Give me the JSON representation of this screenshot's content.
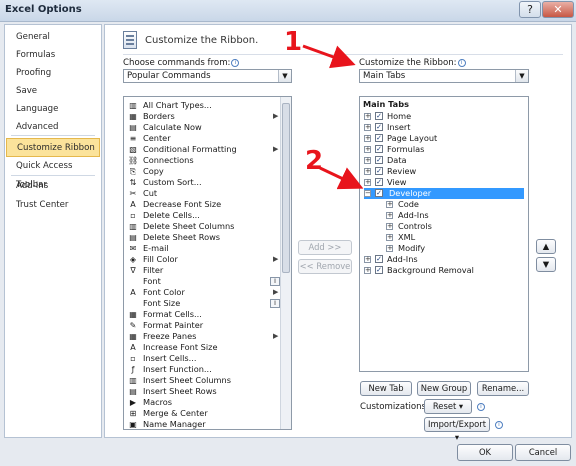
{
  "window": {
    "title": "Excel Options",
    "help_label": "?",
    "close_label": "✕"
  },
  "nav": {
    "items": [
      {
        "label": "General"
      },
      {
        "label": "Formulas"
      },
      {
        "label": "Proofing"
      },
      {
        "label": "Save"
      },
      {
        "label": "Language"
      },
      {
        "label": "Advanced"
      },
      {
        "label": "Customize Ribbon",
        "selected": true
      },
      {
        "label": "Quick Access Toolbar"
      },
      {
        "label": "Add-Ins"
      },
      {
        "label": "Trust Center"
      }
    ]
  },
  "panel": {
    "heading": "Customize the Ribbon.",
    "choose_label": "Choose commands from:",
    "choose_value": "Popular Commands",
    "customize_label": "Customize the Ribbon:",
    "customize_value": "Main Tabs"
  },
  "commands": [
    {
      "label": "All Chart Types...",
      "icon": "▥",
      "icon_name": "chart-icon"
    },
    {
      "label": "Borders",
      "icon": "▦",
      "icon_name": "borders-icon",
      "submenu": true
    },
    {
      "label": "Calculate Now",
      "icon": "▤",
      "icon_name": "calculate-icon"
    },
    {
      "label": "Center",
      "icon": "≡",
      "icon_name": "center-align-icon"
    },
    {
      "label": "Conditional Formatting",
      "icon": "▧",
      "icon_name": "conditional-format-icon",
      "submenu": true
    },
    {
      "label": "Connections",
      "icon": "⛓",
      "icon_name": "connections-icon"
    },
    {
      "label": "Copy",
      "icon": "⎘",
      "icon_name": "copy-icon"
    },
    {
      "label": "Custom Sort...",
      "icon": "⇅",
      "icon_name": "sort-icon"
    },
    {
      "label": "Cut",
      "icon": "✂",
      "icon_name": "cut-icon"
    },
    {
      "label": "Decrease Font Size",
      "icon": "A",
      "icon_name": "decrease-font-icon"
    },
    {
      "label": "Delete Cells...",
      "icon": "▫",
      "icon_name": "delete-cells-icon"
    },
    {
      "label": "Delete Sheet Columns",
      "icon": "▥",
      "icon_name": "delete-columns-icon"
    },
    {
      "label": "Delete Sheet Rows",
      "icon": "▤",
      "icon_name": "delete-rows-icon"
    },
    {
      "label": "E-mail",
      "icon": "✉",
      "icon_name": "email-icon"
    },
    {
      "label": "Fill Color",
      "icon": "◈",
      "icon_name": "fill-color-icon",
      "submenu": true
    },
    {
      "label": "Filter",
      "icon": "∇",
      "icon_name": "filter-icon"
    },
    {
      "label": "Font",
      "icon": "",
      "icon_name": "font-icon",
      "split": "I"
    },
    {
      "label": "Font Color",
      "icon": "A",
      "icon_name": "font-color-icon",
      "submenu": true
    },
    {
      "label": "Font Size",
      "icon": "",
      "icon_name": "font-size-icon",
      "split": "I"
    },
    {
      "label": "Format Cells...",
      "icon": "▦",
      "icon_name": "format-cells-icon"
    },
    {
      "label": "Format Painter",
      "icon": "✎",
      "icon_name": "format-painter-icon"
    },
    {
      "label": "Freeze Panes",
      "icon": "▦",
      "icon_name": "freeze-panes-icon",
      "submenu": true
    },
    {
      "label": "Increase Font Size",
      "icon": "A",
      "icon_name": "increase-font-icon"
    },
    {
      "label": "Insert Cells...",
      "icon": "▫",
      "icon_name": "insert-cells-icon"
    },
    {
      "label": "Insert Function...",
      "icon": "ƒ",
      "icon_name": "insert-function-icon"
    },
    {
      "label": "Insert Sheet Columns",
      "icon": "▥",
      "icon_name": "insert-columns-icon"
    },
    {
      "label": "Insert Sheet Rows",
      "icon": "▤",
      "icon_name": "insert-rows-icon"
    },
    {
      "label": "Macros",
      "icon": "▶",
      "icon_name": "macros-icon"
    },
    {
      "label": "Merge & Center",
      "icon": "⊞",
      "icon_name": "merge-center-icon"
    },
    {
      "label": "Name Manager",
      "icon": "▣",
      "icon_name": "name-manager-icon"
    }
  ],
  "tree": {
    "header": "Main Tabs",
    "items": [
      {
        "label": "Home",
        "level": 0,
        "expander": "+",
        "checked": true
      },
      {
        "label": "Insert",
        "level": 0,
        "expander": "+",
        "checked": true
      },
      {
        "label": "Page Layout",
        "level": 0,
        "expander": "+",
        "checked": true
      },
      {
        "label": "Formulas",
        "level": 0,
        "expander": "+",
        "checked": true
      },
      {
        "label": "Data",
        "level": 0,
        "expander": "+",
        "checked": true
      },
      {
        "label": "Review",
        "level": 0,
        "expander": "+",
        "checked": true
      },
      {
        "label": "View",
        "level": 0,
        "expander": "+",
        "checked": true
      },
      {
        "label": "Developer",
        "level": 0,
        "expander": "−",
        "checked": true,
        "selected": true
      },
      {
        "label": "Code",
        "level": 1,
        "expander": "+"
      },
      {
        "label": "Add-Ins",
        "level": 1,
        "expander": "+"
      },
      {
        "label": "Controls",
        "level": 1,
        "expander": "+"
      },
      {
        "label": "XML",
        "level": 1,
        "expander": "+"
      },
      {
        "label": "Modify",
        "level": 1,
        "expander": "+"
      },
      {
        "label": "Add-Ins",
        "level": 0,
        "expander": "+",
        "checked": true
      },
      {
        "label": "Background Removal",
        "level": 0,
        "expander": "+",
        "checked": true
      }
    ]
  },
  "buttons": {
    "add": "Add >>",
    "remove": "<< Remove",
    "move_up": "▲",
    "move_down": "▼",
    "new_tab": "New Tab",
    "new_group": "New Group",
    "rename": "Rename...",
    "customizations_label": "Customizations:",
    "reset": "Reset ▾",
    "import_export": "Import/Export ▾",
    "ok": "OK",
    "cancel": "Cancel"
  },
  "annotations": {
    "step1": "1",
    "step2": "2",
    "color": "#e8141c"
  }
}
